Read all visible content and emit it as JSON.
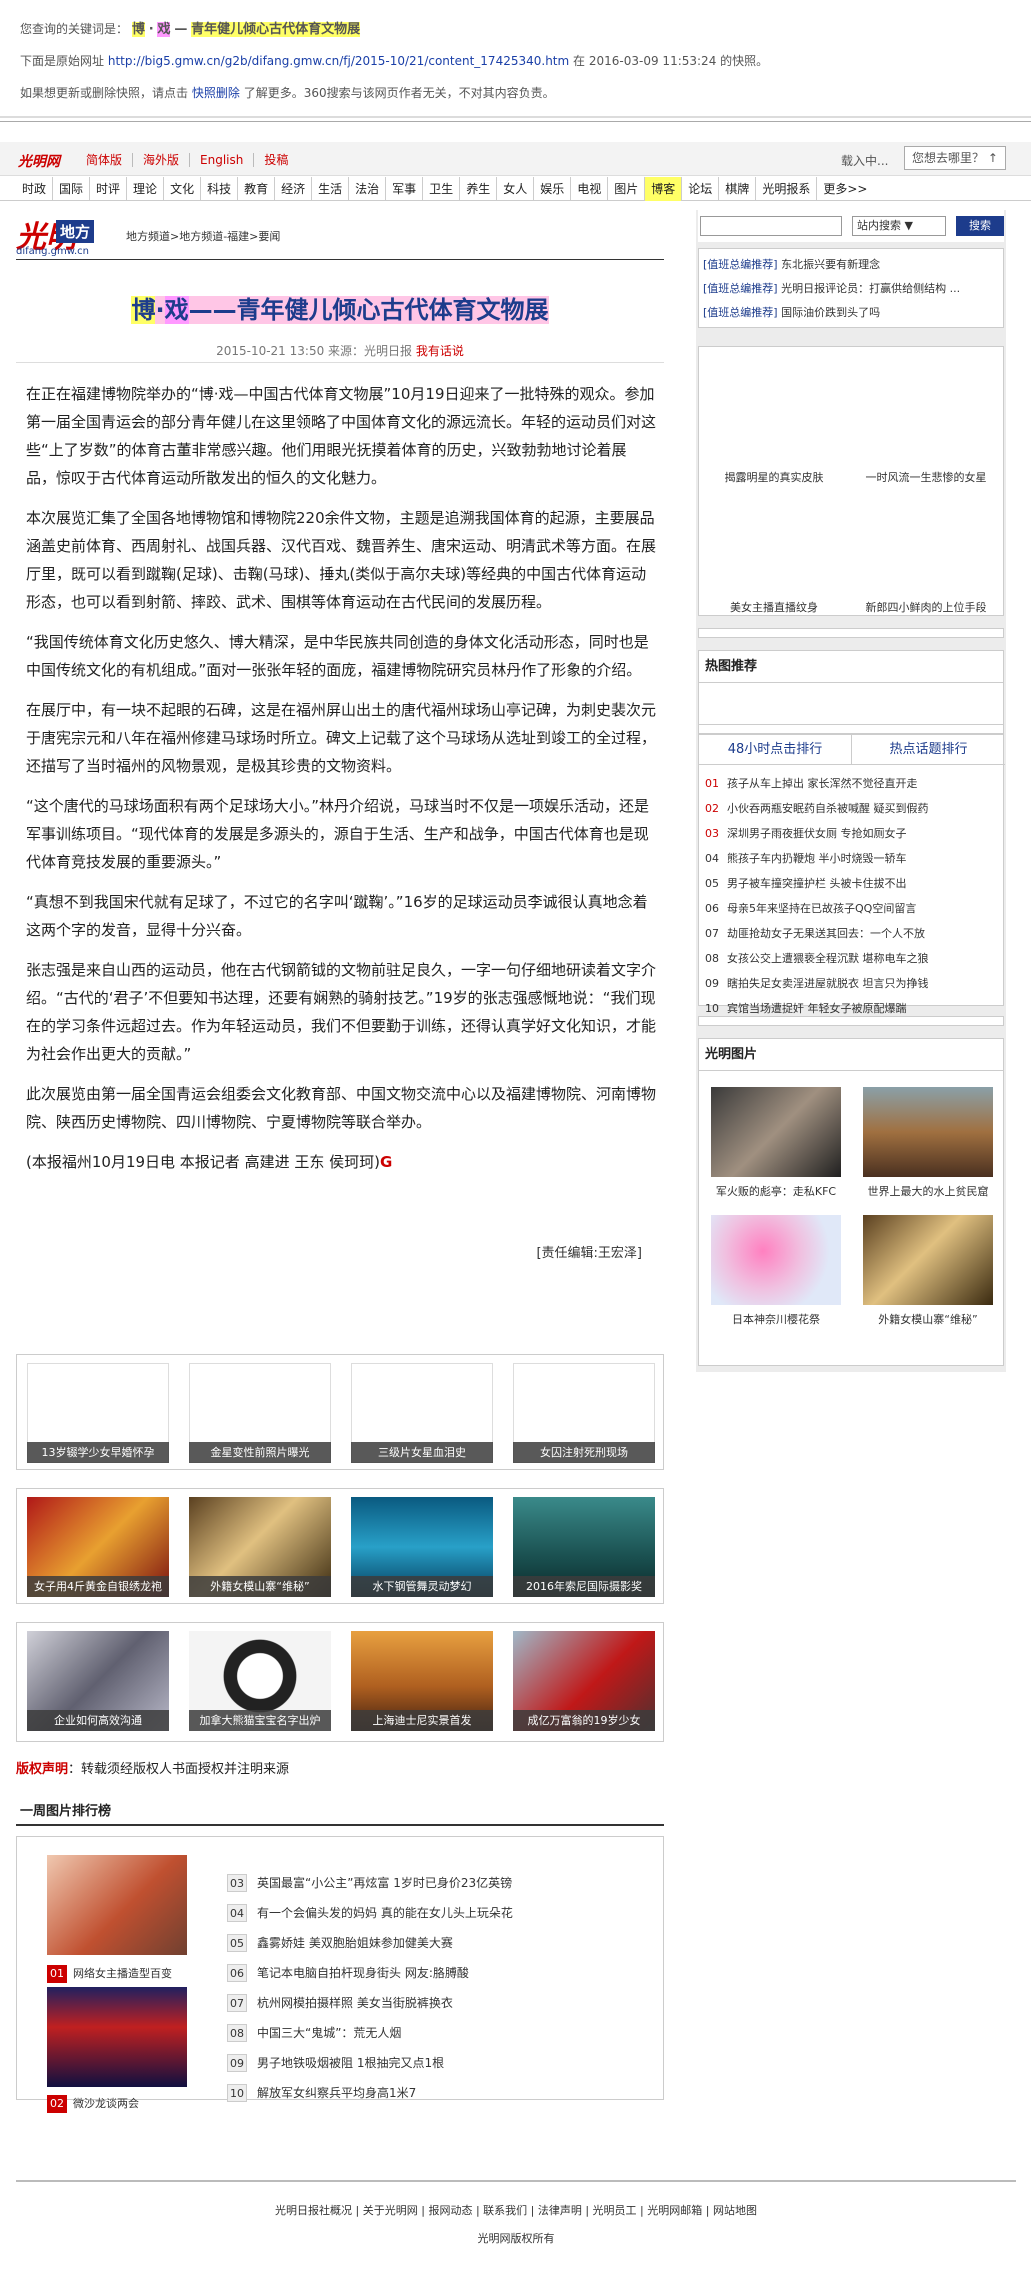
{
  "snapshot": {
    "keyword_prefix": "您查询的关键词是：",
    "keywords": [
      "博",
      "戏",
      "青年健儿倾心古代体育文物展"
    ],
    "line2_prefix": "下面是原始网址",
    "url": "http://big5.gmw.cn/g2b/difang.gmw.cn/fj/2015-10/21/content_17425340.htm",
    "line2_mid": "在",
    "snap_time": "2016-03-09 11:53:24",
    "line2_suffix": "的快照。",
    "line3_prefix": "如果想更新或删除快照，请点击",
    "line3_link": "快照删除",
    "line3_suffix": "了解更多。360搜索与该网页作者无关，不对其内容负责。"
  },
  "topbar": {
    "logo": "光明网",
    "links": [
      "简体版",
      "海外版",
      "English",
      "投稿"
    ],
    "loading": "载入中...",
    "where": "您想去哪里？"
  },
  "nav": [
    "时政",
    "国际",
    "时评",
    "理论",
    "文化",
    "科技",
    "教育",
    "经济",
    "生活",
    "法治",
    "军事",
    "卫生",
    "养生",
    "女人",
    "娱乐",
    "电视",
    "图片",
    "博客",
    "论坛",
    "棋牌",
    "光明报系",
    "更多>>"
  ],
  "header": {
    "logo_gm": "光明",
    "logo_df": "地方",
    "logo_domain": "difang.gmw.cn",
    "breadcrumb": "地方频道>地方频道-福建>要闻"
  },
  "article": {
    "title_a": "博",
    "title_dot": "·",
    "title_b": "戏",
    "title_c": "——青年健儿倾心古代体育文物展",
    "date": "2015-10-21 13:50",
    "source": "来源：光明日报",
    "comment": "我有话说",
    "paragraphs": [
      "在正在福建博物院举办的“博·戏—中国古代体育文物展”10月19日迎来了一批特殊的观众。参加第一届全国青运会的部分青年健儿在这里领略了中国体育文化的源远流长。年轻的运动员们对这些“上了岁数”的体育古董非常感兴趣。他们用眼光抚摸着体育的历史，兴致勃勃地讨论着展品，惊叹于古代体育运动所散发出的恒久的文化魅力。",
      "本次展览汇集了全国各地博物馆和博物院220余件文物，主题是追溯我国体育的起源，主要展品涵盖史前体育、西周射礼、战国兵器、汉代百戏、魏晋养生、唐宋运动、明清武术等方面。在展厅里，既可以看到蹴鞠(足球)、击鞠(马球)、捶丸(类似于高尔夫球)等经典的中国古代体育运动形态，也可以看到射箭、摔跤、武术、围棋等体育运动在古代民间的发展历程。",
      "“我国传统体育文化历史悠久、博大精深，是中华民族共同创造的身体文化活动形态，同时也是中国传统文化的有机组成。”面对一张张年轻的面庞，福建博物院研究员林丹作了形象的介绍。",
      "在展厅中，有一块不起眼的石碑，这是在福州屏山出土的唐代福州球场山亭记碑，为刺史裴次元于唐宪宗元和八年在福州修建马球场时所立。碑文上记载了这个马球场从选址到竣工的全过程，还描写了当时福州的风物景观，是极其珍贵的文物资料。",
      "“这个唐代的马球场面积有两个足球场大小。”林丹介绍说，马球当时不仅是一项娱乐活动，还是军事训练项目。“现代体育的发展是多源头的，源自于生活、生产和战争，中国古代体育也是现代体育竞技发展的重要源头。”",
      "“真想不到我国宋代就有足球了，不过它的名字叫‘蹴鞠’。”16岁的足球运动员李诚很认真地念着这两个字的发音，显得十分兴奋。",
      "张志强是来自山西的运动员，他在古代钢箭钺的文物前驻足良久，一字一句仔细地研读着文字介绍。“古代的‘君子’不但要知书达理，还要有娴熟的骑射技艺。”19岁的张志强感慨地说：“我们现在的学习条件远超过去。作为年轻运动员，我们不但要勤于训练，还得认真学好文化知识，才能为社会作出更大的贡献。”",
      "此次展览由第一届全国青运会组委会文化教育部、中国文物交流中心以及福建博物院、河南博物院、陕西历史博物院、四川博物院、宁夏博物院等联合举办。"
    ],
    "byline": "(本报福州10月19日电 本报记者 高建进 王东 侯珂珂)",
    "byline_mark": "G",
    "editor": "[责任编辑:王宏泽]"
  },
  "thumbs_row1": [
    "13岁辍学少女早婚怀孕",
    "金星变性前照片曝光",
    "三级片女星血泪史",
    "女囚注射死刑现场"
  ],
  "thumbs_row2": [
    "女子用4斤黄金自银绣龙袍",
    "外籍女模山寨“维秘”",
    "水下钢管舞灵动梦幻",
    "2016年索尼国际摄影奖"
  ],
  "thumbs_row3": [
    "企业如何高效沟通",
    "加拿大熊猫宝宝名字出炉",
    "上海迪士尼实景首发",
    "成亿万富翁的19岁少女"
  ],
  "copyright": {
    "label": "版权声明",
    "text": "：转载须经版权人书面授权并注明来源"
  },
  "weekly": {
    "title": "一周图片排行榜",
    "top": [
      {
        "num": "01",
        "label": "网络女主播造型百变"
      },
      {
        "num": "02",
        "label": "微沙龙谈两会"
      }
    ],
    "list": [
      {
        "num": "03",
        "text": "英国最富“小公主”再炫富 1岁时已身价23亿英镑"
      },
      {
        "num": "04",
        "text": "有一个会偏头发的妈妈 真的能在女儿头上玩朵花"
      },
      {
        "num": "05",
        "text": "鑫雾娇娃 美双胞胎姐妹参加健美大赛"
      },
      {
        "num": "06",
        "text": "笔记本电脑自拍杆现身街头 网友:胳膊酸"
      },
      {
        "num": "07",
        "text": "杭州网模拍摄样照 美女当街脱裤换衣"
      },
      {
        "num": "08",
        "text": "中国三大“鬼城”：荒无人烟"
      },
      {
        "num": "09",
        "text": "男子地铁吸烟被阻 1根抽完又点1根"
      },
      {
        "num": "10",
        "text": "解放军女纠察兵平均身高1米7"
      }
    ]
  },
  "footer": {
    "links": "光明日报社概况 | 关于光明网 | 报网动态 | 联系我们 | 法律声明 | 光明员工 | 光明网邮箱 | 网站地图",
    "rights": "光明网版权所有"
  },
  "sidebar": {
    "search_placeholder": "",
    "search_select": "站内搜索",
    "search_button": "搜索",
    "recommend": [
      {
        "tag": "[值班总编推荐]",
        "text": "东北振兴要有新理念"
      },
      {
        "tag": "[值班总编推荐]",
        "text": "光明日报评论员：打赢供给侧结构 ..."
      },
      {
        "tag": "[值班总编推荐]",
        "text": "国际油价跌到头了吗"
      }
    ],
    "pics": [
      "揭露明星的真实皮肤",
      "一时风流一生悲惨的女星",
      "美女主播直播纹身",
      "新郎四小鲜肉的上位手段"
    ],
    "hot_title": "热图推荐",
    "tabs": [
      "48小时点击排行",
      "热点话题排行"
    ],
    "rank": [
      {
        "num": "01",
        "text": "孩子从车上掉出 家长浑然不觉径直开走"
      },
      {
        "num": "02",
        "text": "小伙吞两瓶安眠药自杀被喊醒 疑买到假药"
      },
      {
        "num": "03",
        "text": "深圳男子雨夜捱伏女厕 专抢如厕女子"
      },
      {
        "num": "04",
        "text": "熊孩子车内扔鞭炮 半小时烧毁一轿车"
      },
      {
        "num": "05",
        "text": "男子被车撞突撞护栏 头被卡住拔不出"
      },
      {
        "num": "06",
        "text": "母亲5年来坚持在已故孩子QQ空间留言"
      },
      {
        "num": "07",
        "text": "劫匪抢劫女子无果送其回去：一个人不放"
      },
      {
        "num": "08",
        "text": "女孩公交上遭猥亵全程沉默 堪称电车之狼"
      },
      {
        "num": "09",
        "text": "瞎拍失足女卖淫进屋就脱衣 坦言只为挣钱"
      },
      {
        "num": "10",
        "text": "宾馆当场遭捉奸 年轻女子被原配爆踹"
      }
    ],
    "photo_title": "光明图片",
    "photos": [
      "军火贩的彪亭：走私KFC",
      "世界上最大的水上贫民窟",
      "日本神奈川樱花祭",
      "外籍女模山寨“维秘”"
    ]
  }
}
